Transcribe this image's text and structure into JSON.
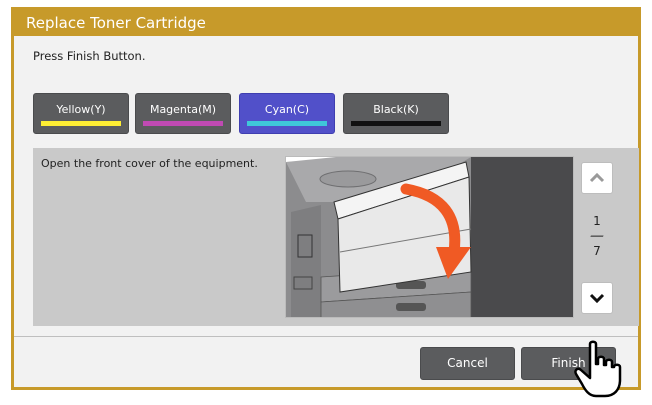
{
  "dialog": {
    "title": "Replace Toner Cartridge",
    "instruction": "Press Finish Button."
  },
  "toner_buttons": [
    {
      "label": "Yellow(Y)",
      "bar_color": "#ffee33",
      "active": false
    },
    {
      "label": "Magenta(M)",
      "bar_color": "#c04ab3",
      "active": false
    },
    {
      "label": "Cyan(C)",
      "bar_color": "#3fc7d9",
      "active": true
    },
    {
      "label": "Black(K)",
      "bar_color": "#111111",
      "active": false
    }
  ],
  "guide": {
    "text": "Open the front cover of the equipment.",
    "page_current": "1",
    "page_total": "7",
    "up_icon": "chevron-up-icon",
    "down_icon": "chevron-down-icon"
  },
  "actions": {
    "cancel_label": "Cancel",
    "finish_label": "Finish"
  },
  "colors": {
    "title_bar": "#c79a2a",
    "button_default": "#5b5c5e",
    "button_active": "#5150c9",
    "arrow": "#f05a24"
  }
}
